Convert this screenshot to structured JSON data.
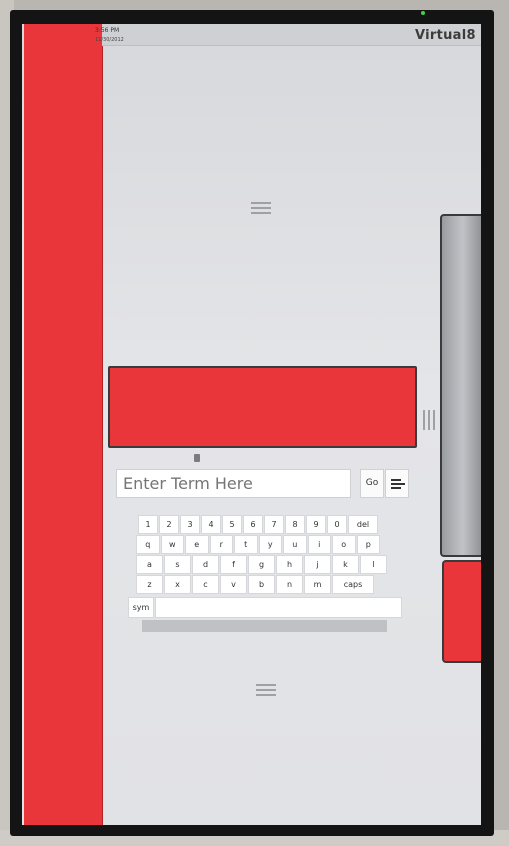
{
  "status_bar": {
    "time": "3:56 PM",
    "date": "11/30/2012",
    "brand": "Virtual8"
  },
  "search": {
    "placeholder": "Enter Term Here",
    "go_label": "Go"
  },
  "keyboard": {
    "row1": [
      "1",
      "2",
      "3",
      "4",
      "5",
      "6",
      "7",
      "8",
      "9",
      "0",
      "del"
    ],
    "row2": [
      "q",
      "w",
      "e",
      "r",
      "t",
      "y",
      "u",
      "i",
      "o",
      "p"
    ],
    "row3": [
      "a",
      "s",
      "d",
      "f",
      "g",
      "h",
      "j",
      "k",
      "l"
    ],
    "row4": [
      "z",
      "x",
      "c",
      "v",
      "b",
      "n",
      "m",
      "caps"
    ],
    "row5_sym": "sym",
    "row5_space": ""
  },
  "colors": {
    "accent_red": "#e8363a",
    "screen_bg": "#e1e2e5"
  },
  "icons": [
    "grip-handle-icon",
    "menu-icon",
    "cursor-icon"
  ]
}
